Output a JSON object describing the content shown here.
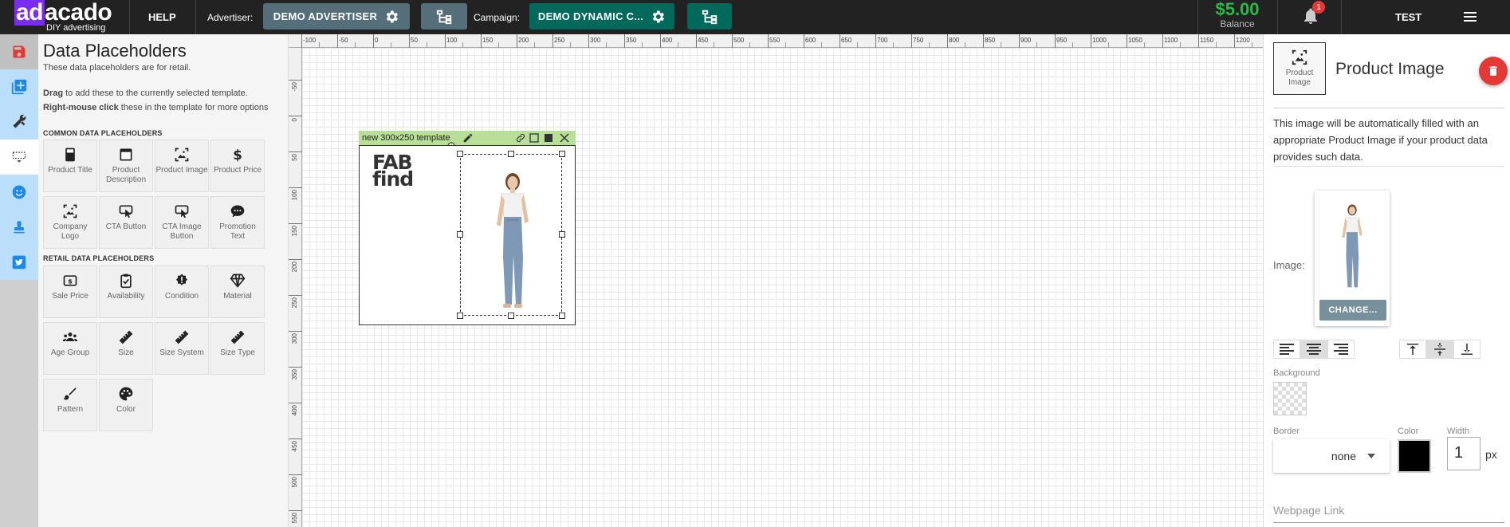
{
  "topbar": {
    "logo_main_a": "ad",
    "logo_main_b": "acado",
    "logo_sub": "DIY advertising",
    "help": "HELP",
    "advertiser_label": "Advertiser:",
    "advertiser_value": "DEMO ADVERTISER",
    "campaign_label": "Campaign:",
    "campaign_value": "DEMO DYNAMIC C...",
    "balance_amount": "$5.00",
    "balance_label": "Balance",
    "notifications": "1",
    "user": "TEST"
  },
  "left_panel": {
    "title": "Data Placeholders",
    "subtitle": "These data placeholders are for retail.",
    "hint1_bold": "Drag",
    "hint1_rest": " to add these to the currently selected template.",
    "hint2_bold": "Right-mouse click",
    "hint2_rest": " these in the template for more options",
    "common_header": "COMMON DATA PLACEHOLDERS",
    "retail_header": "RETAIL DATA PLACEHOLDERS",
    "common": [
      {
        "label": "Product Title",
        "icon": "calculator-icon"
      },
      {
        "label": "Product Description",
        "icon": "window-icon"
      },
      {
        "label": "Product Image",
        "icon": "image-icon"
      },
      {
        "label": "Product Price",
        "icon": "dollar-icon"
      },
      {
        "label": "Company Logo",
        "icon": "image-icon"
      },
      {
        "label": "CTA Button",
        "icon": "click-icon"
      },
      {
        "label": "CTA Image Button",
        "icon": "click-icon"
      },
      {
        "label": "Promotion Text",
        "icon": "chat-icon"
      }
    ],
    "retail": [
      {
        "label": "Sale Price",
        "icon": "money-icon"
      },
      {
        "label": "Availability",
        "icon": "clipboard-check-icon"
      },
      {
        "label": "Condition",
        "icon": "alert-icon"
      },
      {
        "label": "Material",
        "icon": "diamond-icon"
      },
      {
        "label": "Age Group",
        "icon": "group-icon"
      },
      {
        "label": "Size",
        "icon": "ruler-icon"
      },
      {
        "label": "Size System",
        "icon": "ruler-icon"
      },
      {
        "label": "Size Type",
        "icon": "ruler-icon"
      },
      {
        "label": "Pattern",
        "icon": "brush-icon"
      },
      {
        "label": "Color",
        "icon": "palette-icon"
      }
    ]
  },
  "ruler": {
    "top": [
      "-100",
      "-50",
      "0",
      "50",
      "100",
      "150",
      "200",
      "250",
      "300",
      "350",
      "400",
      "450",
      "500",
      "550",
      "600",
      "650",
      "700",
      "750",
      "800",
      "850",
      "900",
      "950",
      "1000",
      "1050",
      "1100",
      "1150",
      "1200"
    ],
    "left": [
      "-50",
      "0",
      "50",
      "100",
      "150",
      "200",
      "250",
      "300",
      "350",
      "400",
      "450",
      "500",
      "550"
    ]
  },
  "template": {
    "name": "new 300x250 template",
    "logo_line1": "FAB",
    "logo_line2": "find"
  },
  "right_panel": {
    "tile_label": "Product Image",
    "title": "Product Image",
    "description": "This image will be automatically filled with an appropriate Product Image if your product data provides such data.",
    "image_label": "Image:",
    "change_button": "CHANGE...",
    "background_label": "Background",
    "border_label": "Border",
    "border_value": "none",
    "color_label": "Color",
    "width_label": "Width",
    "width_value": "1",
    "width_unit": "px",
    "webpage_link_placeholder": "Webpage Link"
  },
  "colors": {
    "topbar": "#222222",
    "advertiser_btn": "#546e7a",
    "campaign_btn": "#00695c",
    "balance": "#2db84b",
    "template_header": "#b7df96",
    "delete": "#e53935"
  }
}
